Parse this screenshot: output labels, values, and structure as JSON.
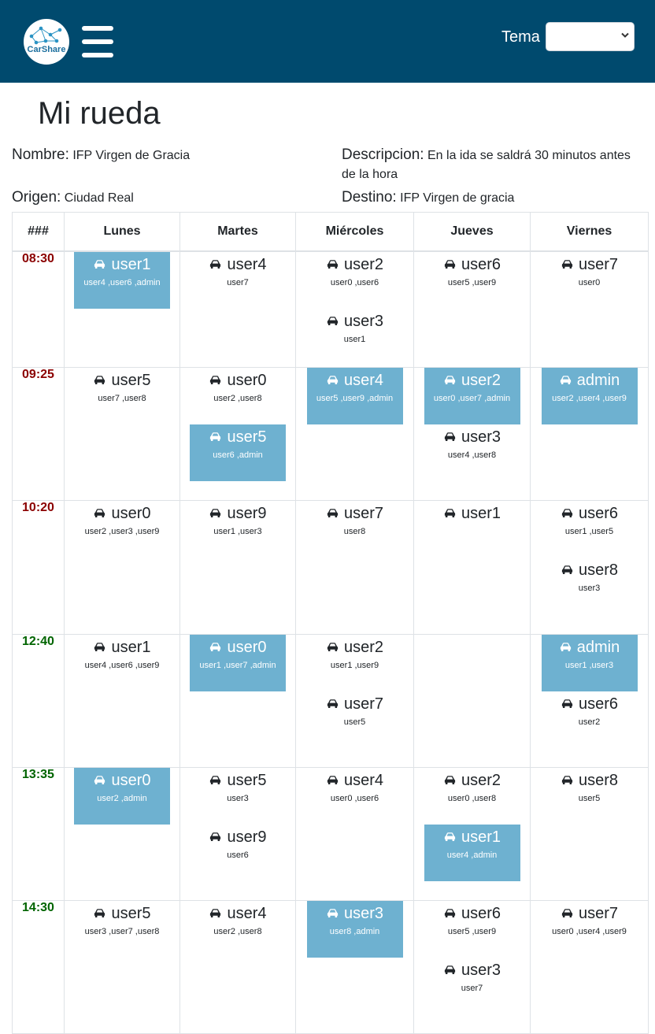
{
  "app": {
    "logo_text": "CarShare",
    "theme_label": "Tema",
    "theme_value": ""
  },
  "page": {
    "title": "Mi rueda"
  },
  "info": {
    "nombre_label": "Nombre:",
    "nombre": "IFP Virgen de Gracia",
    "descripcion_label": "Descripcion:",
    "descripcion": "En la ida se saldrá 30 minutos antes de la hora",
    "origen_label": "Origen:",
    "origen": "Ciudad Real",
    "destino_label": "Destino:",
    "destino": "IFP Virgen de gracia"
  },
  "schedule": {
    "corner": "###",
    "days": [
      "Lunes",
      "Martes",
      "Miércoles",
      "Jueves",
      "Viernes"
    ],
    "rows": [
      {
        "time": "08:30",
        "period": "am",
        "height": 147,
        "cells": [
          [
            {
              "driver": "user1",
              "passengers": "user4 ,user6 ,admin",
              "highlight": true
            }
          ],
          [
            {
              "driver": "user4",
              "passengers": "user7",
              "highlight": false
            }
          ],
          [
            {
              "driver": "user2",
              "passengers": "user0 ,user6",
              "highlight": false
            },
            {
              "driver": "user3",
              "passengers": "user1",
              "highlight": false
            }
          ],
          [
            {
              "driver": "user6",
              "passengers": "user5 ,user9",
              "highlight": false
            }
          ],
          [
            {
              "driver": "user7",
              "passengers": "user0",
              "highlight": false
            }
          ]
        ]
      },
      {
        "time": "09:25",
        "period": "am",
        "height": 169,
        "cells": [
          [
            {
              "driver": "user5",
              "passengers": "user7 ,user8",
              "highlight": false
            }
          ],
          [
            {
              "driver": "user0",
              "passengers": "user2 ,user8",
              "highlight": false
            },
            {
              "driver": "user5",
              "passengers": "user6 ,admin",
              "highlight": true
            }
          ],
          [
            {
              "driver": "user4",
              "passengers": "user5 ,user9 ,admin",
              "highlight": true
            }
          ],
          [
            {
              "driver": "user2",
              "passengers": "user0 ,user7 ,admin",
              "highlight": true
            },
            {
              "driver": "user3",
              "passengers": "user4 ,user8",
              "highlight": false
            }
          ],
          [
            {
              "driver": "admin",
              "passengers": "user2 ,user4 ,user9",
              "highlight": true
            }
          ]
        ]
      },
      {
        "time": "10:20",
        "period": "am",
        "height": 170,
        "cells": [
          [
            {
              "driver": "user0",
              "passengers": "user2 ,user3 ,user9",
              "highlight": false
            }
          ],
          [
            {
              "driver": "user9",
              "passengers": "user1 ,user3",
              "highlight": false
            }
          ],
          [
            {
              "driver": "user7",
              "passengers": "user8",
              "highlight": false
            }
          ],
          [
            {
              "driver": "user1",
              "passengers": "",
              "highlight": false
            }
          ],
          [
            {
              "driver": "user6",
              "passengers": "user1 ,user5",
              "highlight": false
            },
            {
              "driver": "user8",
              "passengers": "user3",
              "highlight": false
            }
          ]
        ]
      },
      {
        "time": "12:40",
        "period": "pm",
        "height": 169,
        "cells": [
          [
            {
              "driver": "user1",
              "passengers": "user4 ,user6 ,user9",
              "highlight": false
            }
          ],
          [
            {
              "driver": "user0",
              "passengers": "user1 ,user7 ,admin",
              "highlight": true
            }
          ],
          [
            {
              "driver": "user2",
              "passengers": "user1 ,user9",
              "highlight": false
            },
            {
              "driver": "user7",
              "passengers": "user5",
              "highlight": false
            }
          ],
          [],
          [
            {
              "driver": "admin",
              "passengers": "user1 ,user3",
              "highlight": true
            },
            {
              "driver": "user6",
              "passengers": "user2",
              "highlight": false
            }
          ]
        ]
      },
      {
        "time": "13:35",
        "period": "pm",
        "height": 169,
        "cells": [
          [
            {
              "driver": "user0",
              "passengers": "user2 ,admin",
              "highlight": true
            }
          ],
          [
            {
              "driver": "user5",
              "passengers": "user3",
              "highlight": false
            },
            {
              "driver": "user9",
              "passengers": "user6",
              "highlight": false
            }
          ],
          [
            {
              "driver": "user4",
              "passengers": "user0 ,user6",
              "highlight": false
            }
          ],
          [
            {
              "driver": "user2",
              "passengers": "user0 ,user8",
              "highlight": false
            },
            {
              "driver": "user1",
              "passengers": "user4 ,admin",
              "highlight": true
            }
          ],
          [
            {
              "driver": "user8",
              "passengers": "user5",
              "highlight": false
            }
          ]
        ]
      },
      {
        "time": "14:30",
        "period": "pm",
        "height": 169,
        "cells": [
          [
            {
              "driver": "user5",
              "passengers": "user3 ,user7 ,user8",
              "highlight": false
            }
          ],
          [
            {
              "driver": "user4",
              "passengers": "user2 ,user8",
              "highlight": false
            }
          ],
          [
            {
              "driver": "user3",
              "passengers": "user8 ,admin",
              "highlight": true
            }
          ],
          [
            {
              "driver": "user6",
              "passengers": "user5 ,user9",
              "highlight": false
            },
            {
              "driver": "user3",
              "passengers": "user7",
              "highlight": false
            }
          ],
          [
            {
              "driver": "user7",
              "passengers": "user0 ,user4 ,user9",
              "highlight": false
            }
          ]
        ]
      }
    ]
  }
}
